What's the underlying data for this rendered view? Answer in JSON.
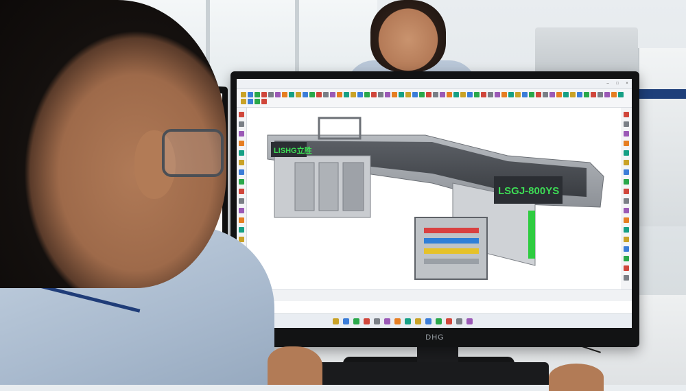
{
  "scene": {
    "description_hidden": true,
    "monitor_brand": "DHG",
    "accent_colors": {
      "shirt": "#aabace",
      "lanyard": "#1f3c78",
      "machine_green": "#2ecc40",
      "machine_panel": "#4a4d52"
    }
  },
  "cad_window": {
    "title": "",
    "toolbar_icons": [
      "save-icon",
      "undo-icon",
      "redo-icon",
      "measure-icon",
      "rotate-icon",
      "zoom-icon",
      "layer-icon",
      "section-icon"
    ],
    "model": {
      "left_label": "LISHG立胜",
      "main_label": "LSGJ-800YS"
    },
    "tray_time": ""
  }
}
